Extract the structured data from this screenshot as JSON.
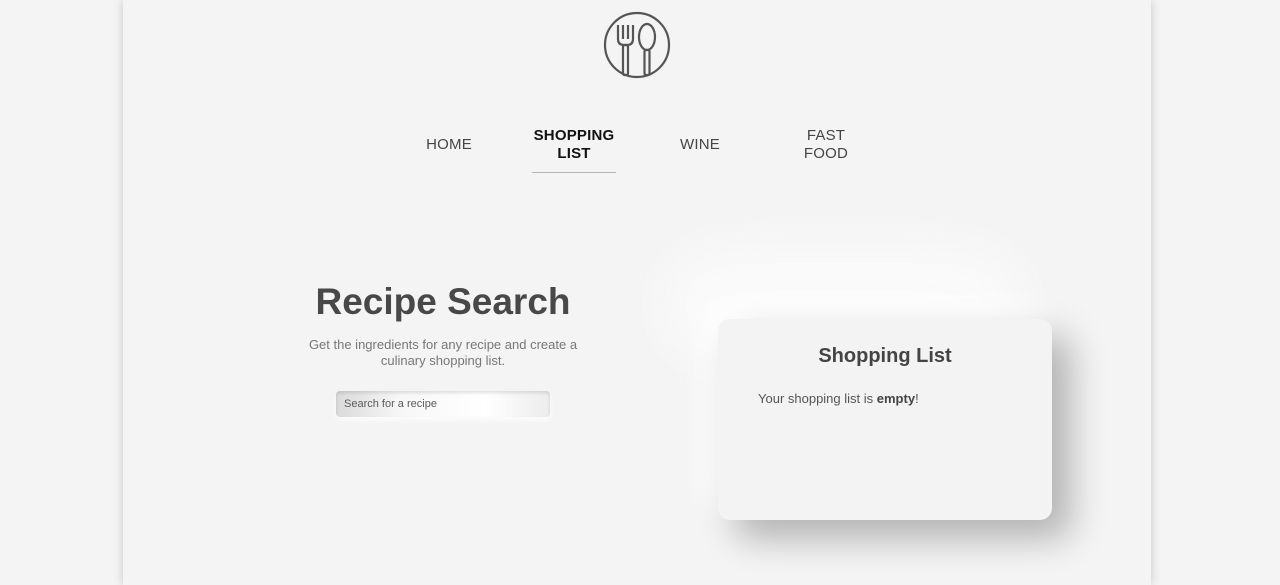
{
  "nav": {
    "items": [
      {
        "label": "HOME"
      },
      {
        "label": "SHOPPING LIST"
      },
      {
        "label": "WINE"
      },
      {
        "label": "FAST FOOD"
      }
    ],
    "active": "SHOPPING LIST"
  },
  "logo": {
    "icon": "fork-spoon-icon"
  },
  "hero": {
    "title": "Recipe Search",
    "subtitle": "Get the ingredients for any recipe and create a culinary shopping list.",
    "search_placeholder": "Search for a recipe"
  },
  "shopping_list": {
    "title": "Shopping List",
    "status_prefix": "Your shopping list is ",
    "status_word": "empty",
    "status_suffix": "!"
  },
  "colors": {
    "background": "#f4f4f4",
    "text_dark": "#484848",
    "text_muted": "#777777"
  }
}
